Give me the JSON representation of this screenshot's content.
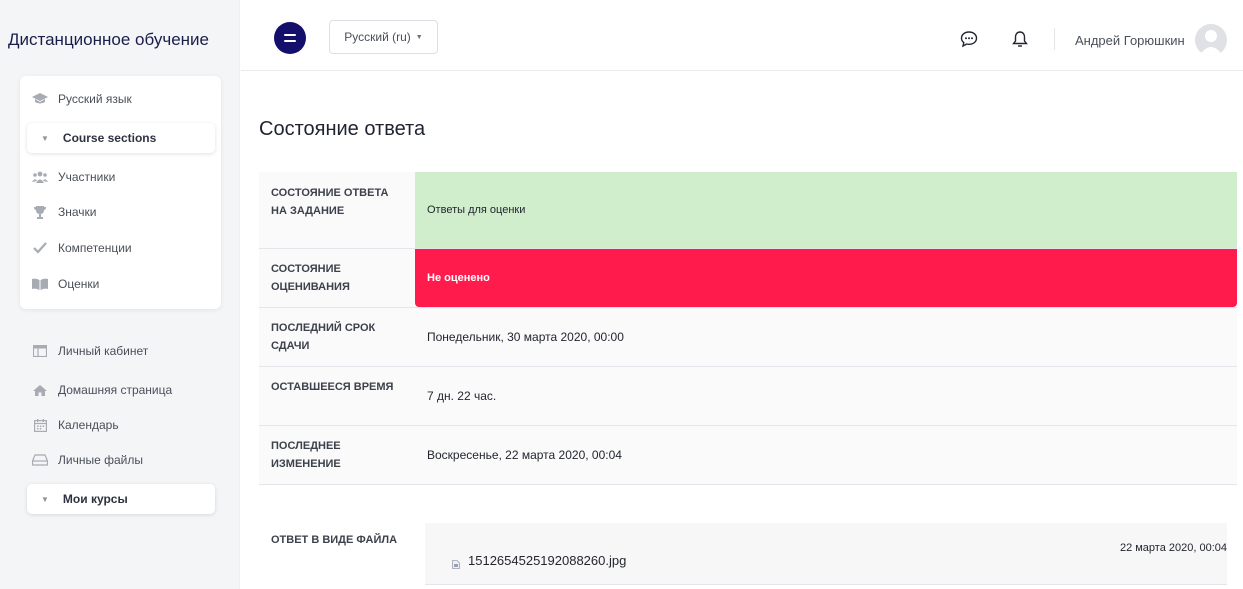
{
  "brand": "Дистанционное обучение",
  "sidebar": {
    "course_name": "Русский язык",
    "course_sections_label": "Course sections",
    "course_items": [
      {
        "label": "Участники",
        "icon": "users-icon"
      },
      {
        "label": "Значки",
        "icon": "trophy-icon"
      },
      {
        "label": "Компетенции",
        "icon": "check-icon"
      },
      {
        "label": "Оценки",
        "icon": "book-icon"
      }
    ],
    "nav_items": [
      {
        "label": "Личный кабинет",
        "icon": "dashboard-icon"
      },
      {
        "label": "Домашняя страница",
        "icon": "home-icon"
      },
      {
        "label": "Календарь",
        "icon": "calendar-icon"
      },
      {
        "label": "Личные файлы",
        "icon": "drive-icon"
      }
    ],
    "my_courses_label": "Мои курсы"
  },
  "topbar": {
    "language": "Русский (ru)",
    "user_name": "Андрей Горюшкин"
  },
  "main": {
    "title": "Состояние ответа",
    "rows": [
      {
        "label": "Состояние ответа на задание",
        "value": "Ответы для оценки"
      },
      {
        "label": "Состояние оценивания",
        "value": "Не оценено"
      },
      {
        "label": "Последний срок сдачи",
        "value": "Понедельник, 30 марта 2020, 00:00"
      },
      {
        "label": "Оставшееся время",
        "value": "7 дн. 22 час."
      },
      {
        "label": "Последнее изменение",
        "value": "Воскресенье, 22 марта 2020, 00:04"
      }
    ],
    "file_submission": {
      "label": "ОТВЕТ В ВИДЕ ФАЙЛА",
      "file_name": "1512654525192088260.jpg",
      "file_date": "22 марта 2020, 00:04"
    }
  },
  "colors": {
    "brand_dark": "#130f6b",
    "status_green": "#d0edcc",
    "status_red": "#ff1c4d"
  }
}
